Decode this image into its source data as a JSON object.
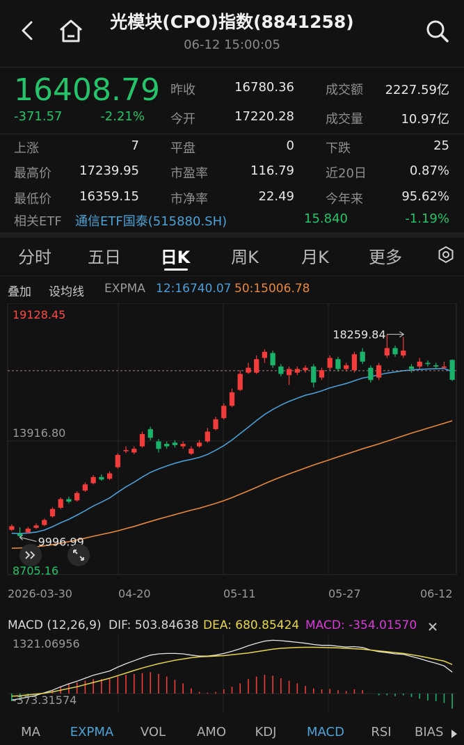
{
  "header": {
    "title": "光模块(CPO)指数(8841258)",
    "time": "06-12 15:00:05"
  },
  "quote": {
    "price": "16408.79",
    "change": "-371.57",
    "change_pct": "-2.21%",
    "fields": [
      {
        "label": "昨收",
        "value": "16780.36"
      },
      {
        "label": "今开",
        "value": "17220.28"
      },
      {
        "label": "成交额",
        "value": "2227.59亿"
      },
      {
        "label": "成交量",
        "value": "10.97亿"
      },
      {
        "label": "上涨",
        "value": "7"
      },
      {
        "label": "平盘",
        "value": "0"
      },
      {
        "label": "下跌",
        "value": "25"
      },
      {
        "label": "最高价",
        "value": "17239.95"
      },
      {
        "label": "市盈率",
        "value": "116.79"
      },
      {
        "label": "近20日",
        "value": "0.87%"
      },
      {
        "label": "最低价",
        "value": "16359.15"
      },
      {
        "label": "市净率",
        "value": "22.49"
      },
      {
        "label": "今年来",
        "value": "95.62%"
      }
    ],
    "etf": {
      "label": "相关ETF",
      "name": "通信ETF国泰(515880.SH)",
      "price": "15.840",
      "pct": "-1.19%"
    }
  },
  "tabs": [
    "分时",
    "五日",
    "日K",
    "周K",
    "月K",
    "更多"
  ],
  "active_tab": "日K",
  "toolbar": {
    "overlay": "叠加",
    "ma_setting": "设均线",
    "expma_label": "EXPMA",
    "expma12": "12:16740.07",
    "expma50": "50:15006.78"
  },
  "chart_data": {
    "type": "candlestick",
    "y_max_label": "19128.45",
    "y_mid_label": "13916.80",
    "y_min_label": "8705.16",
    "ylim": [
      8705.16,
      19128.45
    ],
    "x_labels": [
      "2026-03-30",
      "04-20",
      "05-11",
      "05-27",
      "06-12"
    ],
    "annotations": {
      "high": "18259.84",
      "low": "9996.99"
    },
    "reference_line": 16780.36,
    "candles": [
      {
        "o": 10300,
        "c": 10450,
        "h": 10520,
        "l": 10250
      },
      {
        "o": 10150,
        "c": 10050,
        "h": 10400,
        "l": 9997
      },
      {
        "o": 10200,
        "c": 10350,
        "h": 10420,
        "l": 10150
      },
      {
        "o": 10380,
        "c": 10480,
        "h": 10560,
        "l": 10330
      },
      {
        "o": 10500,
        "c": 10700,
        "h": 10760,
        "l": 10450
      },
      {
        "o": 10850,
        "c": 11150,
        "h": 11220,
        "l": 10800
      },
      {
        "o": 11200,
        "c": 11550,
        "h": 11620,
        "l": 11150
      },
      {
        "o": 11550,
        "c": 11450,
        "h": 11650,
        "l": 11380
      },
      {
        "o": 11500,
        "c": 11800,
        "h": 11870,
        "l": 11450
      },
      {
        "o": 11900,
        "c": 12150,
        "h": 12230,
        "l": 11850
      },
      {
        "o": 12200,
        "c": 12450,
        "h": 12530,
        "l": 12150
      },
      {
        "o": 12450,
        "c": 12350,
        "h": 12560,
        "l": 12300
      },
      {
        "o": 12380,
        "c": 12600,
        "h": 12680,
        "l": 12330
      },
      {
        "o": 12850,
        "c": 13350,
        "h": 13420,
        "l": 12800
      },
      {
        "o": 13500,
        "c": 13550,
        "h": 13700,
        "l": 13420
      },
      {
        "o": 13450,
        "c": 13600,
        "h": 13700,
        "l": 13380
      },
      {
        "o": 13700,
        "c": 14200,
        "h": 14300,
        "l": 13650
      },
      {
        "o": 14400,
        "c": 14050,
        "h": 14500,
        "l": 13950
      },
      {
        "o": 13900,
        "c": 13600,
        "h": 14000,
        "l": 13450
      },
      {
        "o": 13800,
        "c": 13700,
        "h": 13900,
        "l": 13600
      },
      {
        "o": 13850,
        "c": 13750,
        "h": 13950,
        "l": 13650
      },
      {
        "o": 13700,
        "c": 13800,
        "h": 13900,
        "l": 13600
      },
      {
        "o": 13400,
        "c": 13600,
        "h": 13700,
        "l": 13350
      },
      {
        "o": 13700,
        "c": 13850,
        "h": 13950,
        "l": 13650
      },
      {
        "o": 13900,
        "c": 14300,
        "h": 14450,
        "l": 13850
      },
      {
        "o": 14400,
        "c": 14800,
        "h": 14900,
        "l": 14350
      },
      {
        "o": 14850,
        "c": 15350,
        "h": 15450,
        "l": 14800
      },
      {
        "o": 15350,
        "c": 15900,
        "h": 16050,
        "l": 15300
      },
      {
        "o": 16000,
        "c": 16650,
        "h": 16800,
        "l": 15950
      },
      {
        "o": 16700,
        "c": 16900,
        "h": 17100,
        "l": 16650
      },
      {
        "o": 16700,
        "c": 17250,
        "h": 17400,
        "l": 16650
      },
      {
        "o": 17300,
        "c": 17550,
        "h": 17650,
        "l": 17100
      },
      {
        "o": 17500,
        "c": 17000,
        "h": 17600,
        "l": 16900
      },
      {
        "o": 16950,
        "c": 16650,
        "h": 17050,
        "l": 16550
      },
      {
        "o": 16600,
        "c": 16850,
        "h": 16950,
        "l": 16200
      },
      {
        "o": 16700,
        "c": 16850,
        "h": 16950,
        "l": 16600
      },
      {
        "o": 16800,
        "c": 16900,
        "h": 17000,
        "l": 16700
      },
      {
        "o": 16950,
        "c": 16300,
        "h": 17050,
        "l": 16100
      },
      {
        "o": 16500,
        "c": 16800,
        "h": 16900,
        "l": 16400
      },
      {
        "o": 16900,
        "c": 17300,
        "h": 17400,
        "l": 16800
      },
      {
        "o": 17250,
        "c": 16850,
        "h": 17350,
        "l": 16750
      },
      {
        "o": 16850,
        "c": 17000,
        "h": 17100,
        "l": 16750
      },
      {
        "o": 16800,
        "c": 17450,
        "h": 17550,
        "l": 16700
      },
      {
        "o": 17550,
        "c": 17150,
        "h": 17700,
        "l": 17050
      },
      {
        "o": 16900,
        "c": 16400,
        "h": 17000,
        "l": 16300
      },
      {
        "o": 16500,
        "c": 17000,
        "h": 17100,
        "l": 16400
      },
      {
        "o": 17400,
        "c": 17700,
        "h": 18260,
        "l": 17300
      },
      {
        "o": 17700,
        "c": 17450,
        "h": 17800,
        "l": 17350
      },
      {
        "o": 17400,
        "c": 17600,
        "h": 18150,
        "l": 17300
      },
      {
        "o": 16950,
        "c": 16850,
        "h": 17050,
        "l": 16700
      },
      {
        "o": 16950,
        "c": 17150,
        "h": 17300,
        "l": 16850
      },
      {
        "o": 17100,
        "c": 17050,
        "h": 17200,
        "l": 16950
      },
      {
        "o": 17000,
        "c": 16950,
        "h": 17100,
        "l": 16850
      },
      {
        "o": 16900,
        "c": 16950,
        "h": 17150,
        "l": 16850
      },
      {
        "o": 17220,
        "c": 16409,
        "h": 17240,
        "l": 16359
      }
    ],
    "ema12": [
      10160,
      10150,
      10170,
      10210,
      10290,
      10430,
      10590,
      10730,
      10900,
      11080,
      11270,
      11430,
      11600,
      11830,
      12050,
      12240,
      12450,
      12640,
      12780,
      12900,
      13010,
      13100,
      13170,
      13250,
      13370,
      13540,
      13730,
      13960,
      14220,
      14480,
      14750,
      15000,
      15200,
      15380,
      15530,
      15660,
      15780,
      15860,
      15960,
      16080,
      16170,
      16260,
      16370,
      16480,
      16540,
      16610,
      16680,
      16730,
      16780,
      16810,
      16830,
      16850,
      16860,
      16870,
      16740
    ],
    "ema50": [
      9550,
      9560,
      9580,
      9610,
      9650,
      9700,
      9760,
      9820,
      9890,
      9960,
      10040,
      10110,
      10180,
      10260,
      10350,
      10440,
      10540,
      10640,
      10740,
      10830,
      10920,
      11010,
      11100,
      11180,
      11280,
      11380,
      11490,
      11610,
      11750,
      11890,
      12030,
      12180,
      12320,
      12450,
      12580,
      12700,
      12820,
      12940,
      13050,
      13160,
      13270,
      13380,
      13490,
      13600,
      13700,
      13800,
      13910,
      14020,
      14130,
      14240,
      14340,
      14440,
      14540,
      14640,
      14740
    ]
  },
  "macd": {
    "label": "MACD (12,26,9)",
    "dif": "DIF: 503.84638",
    "dea": "DEA: 680.85424",
    "macd": "MACD: -354.01570",
    "y_max_label": "1321.06956",
    "y_min_label": "-373.31574",
    "ylim": [
      -373.31574,
      1321.06956
    ],
    "dif_values": [
      -150,
      -120,
      -80,
      -40,
      20,
      80,
      160,
      230,
      290,
      360,
      430,
      480,
      530,
      620,
      700,
      770,
      840,
      900,
      930,
      940,
      940,
      930,
      900,
      880,
      880,
      900,
      940,
      990,
      1050,
      1120,
      1180,
      1230,
      1250,
      1240,
      1220,
      1200,
      1180,
      1150,
      1130,
      1130,
      1110,
      1090,
      1100,
      1080,
      1020,
      980,
      960,
      930,
      920,
      870,
      820,
      760,
      710,
      650,
      504
    ],
    "dea_values": [
      -60,
      -50,
      -30,
      -10,
      10,
      40,
      80,
      120,
      160,
      210,
      260,
      310,
      360,
      420,
      480,
      540,
      600,
      650,
      700,
      740,
      780,
      810,
      840,
      860,
      870,
      880,
      890,
      910,
      930,
      950,
      980,
      1010,
      1040,
      1060,
      1070,
      1080,
      1085,
      1085,
      1080,
      1075,
      1070,
      1060,
      1050,
      1040,
      1020,
      1000,
      980,
      960,
      940,
      910,
      880,
      840,
      800,
      760,
      681
    ],
    "hist_values": [
      -180,
      -140,
      -100,
      -60,
      20,
      80,
      160,
      220,
      260,
      300,
      340,
      340,
      340,
      400,
      440,
      460,
      480,
      500,
      460,
      400,
      320,
      240,
      120,
      40,
      20,
      40,
      100,
      160,
      240,
      340,
      400,
      440,
      420,
      360,
      300,
      240,
      180,
      120,
      100,
      110,
      80,
      60,
      100,
      80,
      0,
      -40,
      -40,
      -60,
      -40,
      -80,
      -120,
      -160,
      -180,
      -220,
      -354
    ]
  },
  "bottom_tabs": [
    "MA",
    "EXPMA",
    "VOL",
    "AMO",
    "KDJ",
    "MACD",
    "RSI",
    "BIAS"
  ],
  "bottom_active": [
    "EXPMA",
    "MACD"
  ],
  "colors": {
    "up": "#f23c3c",
    "down": "#19b36b",
    "ema12": "#4a9fd8",
    "ema50": "#e8893a",
    "dif": "#e6e6e6",
    "dea": "#e6d84a",
    "accent": "#4aa3d6"
  }
}
